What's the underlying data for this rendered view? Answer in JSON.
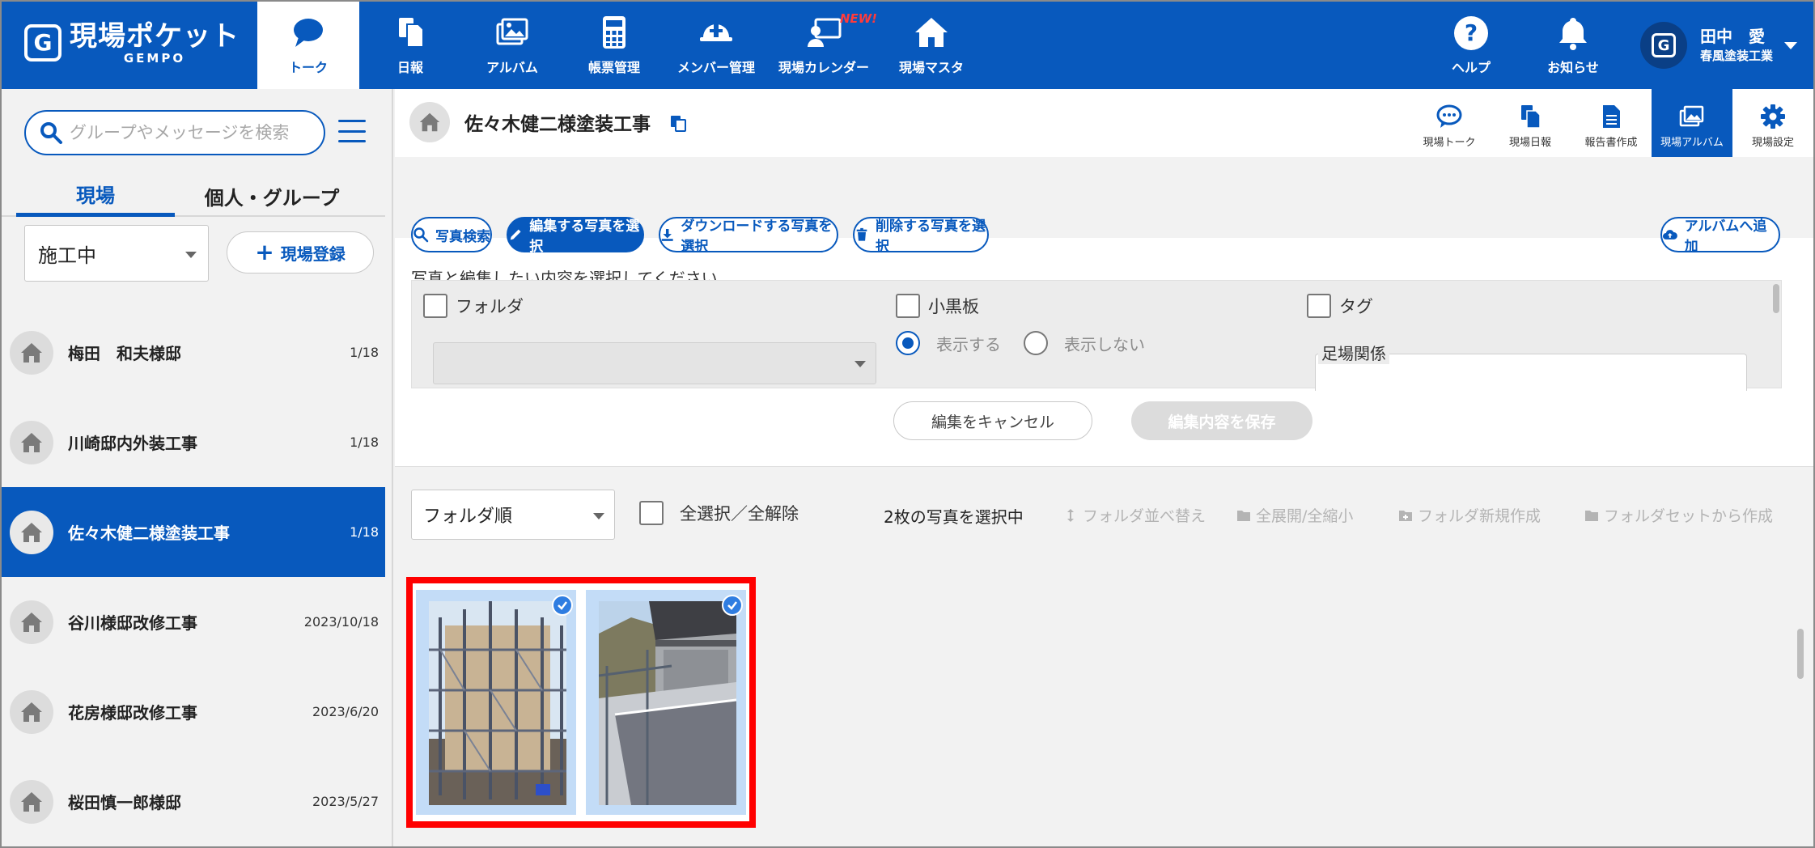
{
  "brand": {
    "name": "現場ポケット",
    "sub": "GEMPO",
    "mark": "G"
  },
  "nav": {
    "items": [
      {
        "label": "トーク",
        "icon": "chat-bubble-icon"
      },
      {
        "label": "日報",
        "icon": "daily-report-icon"
      },
      {
        "label": "アルバム",
        "icon": "album-icon"
      },
      {
        "label": "帳票管理",
        "icon": "calculator-icon"
      },
      {
        "label": "メンバー管理",
        "icon": "helmet-icon"
      },
      {
        "label": "現場カレンダー",
        "icon": "calendar-screen-icon",
        "badge": "NEW!"
      },
      {
        "label": "現場マスタ",
        "icon": "house-icon"
      }
    ]
  },
  "topright": {
    "help": "ヘルプ",
    "notice": "お知らせ",
    "user_name": "田中　愛",
    "user_company": "春風塗装工業"
  },
  "sidebar": {
    "search_placeholder": "グループやメッセージを検索",
    "tab_sites": "現場",
    "tab_groups": "個人・グループ",
    "status_value": "施工中",
    "add_site": "現場登録",
    "sites": [
      {
        "name": "梅田　和夫様邸",
        "date": "1/18"
      },
      {
        "name": "川崎邸内外装工事",
        "date": "1/18"
      },
      {
        "name": "佐々木健二様塗装工事",
        "date": "1/18",
        "active": true
      },
      {
        "name": "谷川様邸改修工事",
        "date": "2023/10/18"
      },
      {
        "name": "花房様邸改修工事",
        "date": "2023/6/20"
      },
      {
        "name": "桜田慎一郎様邸",
        "date": "2023/5/27"
      }
    ]
  },
  "main": {
    "project_title": "佐々木健二様塗装工事",
    "subnav": [
      {
        "label": "現場トーク",
        "icon": "chat-bubble-icon"
      },
      {
        "label": "現場日報",
        "icon": "daily-report-icon"
      },
      {
        "label": "報告書作成",
        "icon": "document-icon"
      },
      {
        "label": "現場アルバム",
        "icon": "album-icon",
        "active": true
      },
      {
        "label": "現場設定",
        "icon": "gear-icon"
      }
    ],
    "toolbar": {
      "photo_search": "写真検索",
      "select_edit": "編集する写真を選択",
      "select_download": "ダウンロードする写真を選択",
      "select_delete": "削除する写真を選択",
      "add_album": "アルバムへ追加"
    },
    "instruction": "写真と編集したい内容を選択してください。",
    "edit_panel": {
      "folder_label": "フォルダ",
      "blackboard_label": "小黒板",
      "show_label": "表示する",
      "hide_label": "表示しない",
      "show_selected": true,
      "tag_label": "タグ",
      "tag_group": "足場関係"
    },
    "cancel_edit": "編集をキャンセル",
    "save_edit": "編集内容を保存",
    "photo_bar": {
      "sort_value": "フォルダ順",
      "select_all": "全選択／全解除",
      "selected_count": "2枚の写真を選択中",
      "reorder": "フォルダ並べ替え",
      "expand": "全展開/全縮小",
      "new_folder": "フォルダ新規作成",
      "from_set": "フォルダセットから作成"
    },
    "photos_selected": 2
  },
  "colors": {
    "primary": "#0859bd",
    "highlight": "#ff0000",
    "selected_bg": "#c3dcf7",
    "new_badge": "#ff3b3b"
  }
}
